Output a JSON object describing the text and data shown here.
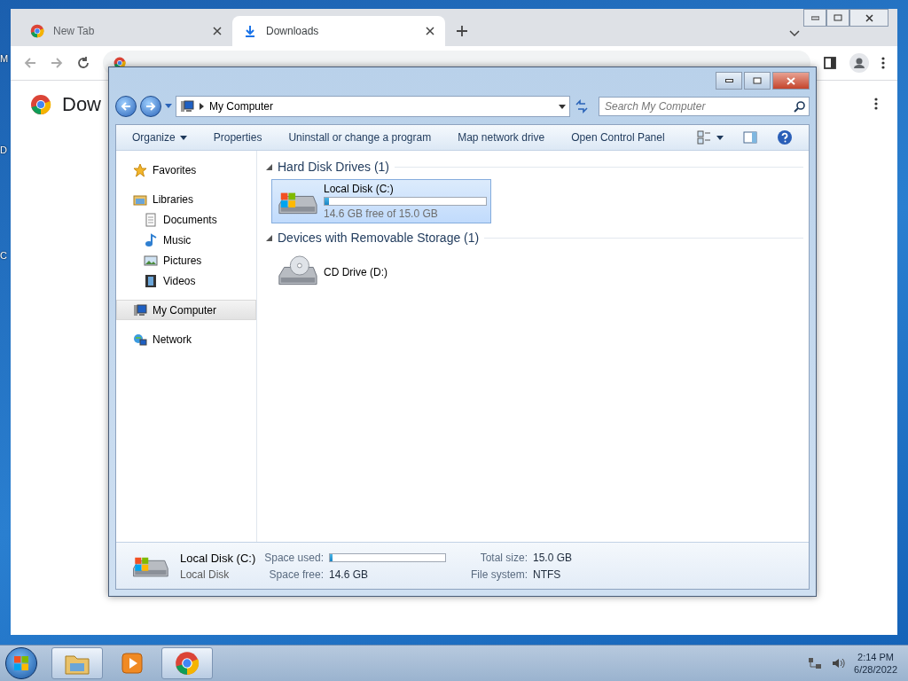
{
  "desktop_labels": [
    "M",
    "D",
    "C"
  ],
  "browser": {
    "tabs": [
      {
        "title": "New Tab",
        "selected": false,
        "kind": "chrome"
      },
      {
        "title": "Downloads",
        "selected": true,
        "kind": "download"
      }
    ],
    "page_title": "Dow"
  },
  "explorer": {
    "breadcrumb": "My Computer",
    "search": {
      "placeholder": "Search My Computer"
    },
    "commands": [
      {
        "label": "Organize",
        "menu": true
      },
      {
        "label": "Properties",
        "menu": false
      },
      {
        "label": "Uninstall or change a program",
        "menu": false
      },
      {
        "label": "Map network drive",
        "menu": false
      },
      {
        "label": "Open Control Panel",
        "menu": false
      }
    ],
    "nav": [
      {
        "label": "Favorites",
        "kind": "star",
        "selected": false
      },
      {
        "label": "Libraries",
        "kind": "library",
        "selected": false,
        "children": [
          {
            "label": "Documents",
            "kind": "document",
            "selected": false
          },
          {
            "label": "Music",
            "kind": "music",
            "selected": false
          },
          {
            "label": "Pictures",
            "kind": "pictures",
            "selected": false
          },
          {
            "label": "Videos",
            "kind": "videos",
            "selected": false
          }
        ]
      },
      {
        "label": "My Computer",
        "kind": "computer",
        "selected": true
      },
      {
        "label": "Network",
        "kind": "network",
        "selected": false
      }
    ],
    "groups": [
      {
        "title": "Hard Disk Drives (1)",
        "items": [
          {
            "kind": "disk",
            "name": "Local Disk (C:)",
            "level": 0.027,
            "caption": "14.6 GB free of 15.0 GB",
            "selected": true
          }
        ]
      },
      {
        "title": "Devices with Removable Storage (1)",
        "items": [
          {
            "kind": "cd",
            "name": "CD Drive (D:)",
            "selected": false
          }
        ]
      }
    ],
    "details": {
      "rows": [
        {
          "title": "Local Disk (C:)",
          "fields": [
            {
              "label": "Space used:",
              "kind": "bar",
              "level": 0.027
            },
            {
              "label": "Total size:",
              "kind": "text",
              "value": "15.0 GB"
            }
          ]
        },
        {
          "title": "Local Disk",
          "fields": [
            {
              "label": "Space free:",
              "kind": "text",
              "value": "14.6 GB"
            },
            {
              "label": "File system:",
              "kind": "text",
              "value": "NTFS"
            }
          ]
        }
      ]
    }
  },
  "taskbar": {
    "apps": [
      {
        "kind": "folder",
        "open": true
      },
      {
        "kind": "media",
        "open": false
      },
      {
        "kind": "chrome",
        "open": true
      }
    ],
    "time": "2:14 PM",
    "date": "6/28/2022"
  }
}
